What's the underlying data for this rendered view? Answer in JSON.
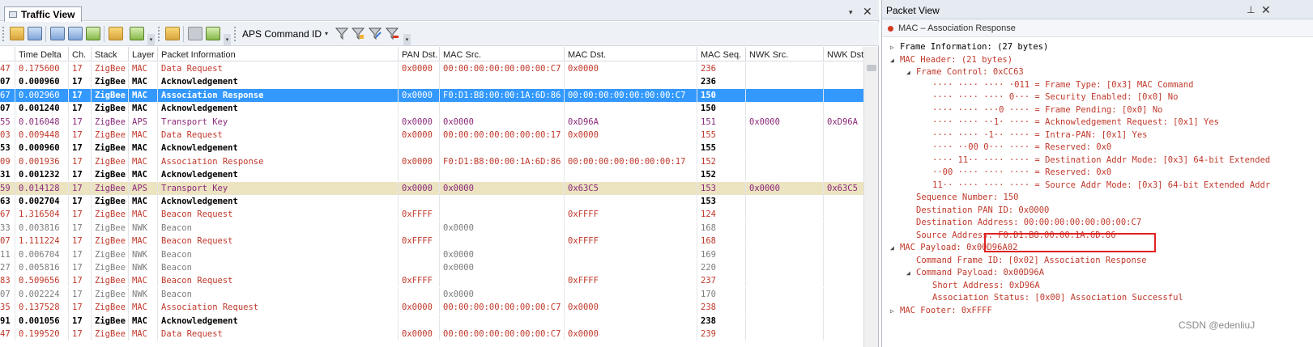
{
  "left_pane": {
    "tab_label": "Traffic View",
    "dropdown_glyph": "▾",
    "close_glyph": "✕"
  },
  "toolbar": {
    "protocol_filter": "APS Command ID",
    "combo_arrow": "▾"
  },
  "grid": {
    "columns": [
      "",
      "Time Delta",
      "Ch.",
      "Stack",
      "Layer",
      "Packet Information",
      "PAN Dst.",
      "MAC Src.",
      "MAC Dst.",
      "MAC Seq.",
      "NWK Src.",
      "NWK Dst."
    ],
    "rows": [
      {
        "id": "47",
        "time": "0.175600",
        "ch": "17",
        "stack": "ZigBee",
        "layer": "MAC",
        "info": "Data Request",
        "pan": "0x0000",
        "msrc": "00:00:00:00:00:00:00:C7",
        "mdst": "0x0000",
        "seq": "236",
        "nsrc": "",
        "ndst": "",
        "style": "red"
      },
      {
        "id": "07",
        "time": "0.000960",
        "ch": "17",
        "stack": "ZigBee",
        "layer": "MAC",
        "info": "Acknowledgement",
        "pan": "",
        "msrc": "",
        "mdst": "",
        "seq": "236",
        "nsrc": "",
        "ndst": "",
        "style": "black"
      },
      {
        "id": "67",
        "time": "0.002960",
        "ch": "17",
        "stack": "ZigBee",
        "layer": "MAC",
        "info": "Association Response",
        "pan": "0x0000",
        "msrc": "F0:D1:B8:00:00:1A:6D:86",
        "mdst": "00:00:00:00:00:00:00:C7",
        "seq": "150",
        "nsrc": "",
        "ndst": "",
        "style": "selected"
      },
      {
        "id": "07",
        "time": "0.001240",
        "ch": "17",
        "stack": "ZigBee",
        "layer": "MAC",
        "info": "Acknowledgement",
        "pan": "",
        "msrc": "",
        "mdst": "",
        "seq": "150",
        "nsrc": "",
        "ndst": "",
        "style": "black"
      },
      {
        "id": "55",
        "time": "0.016048",
        "ch": "17",
        "stack": "ZigBee",
        "layer": "APS",
        "info": "Transport Key",
        "pan": "0x0000",
        "msrc": "0x0000",
        "mdst": "0xD96A",
        "seq": "151",
        "nsrc": "0x0000",
        "ndst": "0xD96A",
        "style": "purple"
      },
      {
        "id": "03",
        "time": "0.009448",
        "ch": "17",
        "stack": "ZigBee",
        "layer": "MAC",
        "info": "Data Request",
        "pan": "0x0000",
        "msrc": "00:00:00:00:00:00:00:17",
        "mdst": "0x0000",
        "seq": "155",
        "nsrc": "",
        "ndst": "",
        "style": "red"
      },
      {
        "id": "53",
        "time": "0.000960",
        "ch": "17",
        "stack": "ZigBee",
        "layer": "MAC",
        "info": "Acknowledgement",
        "pan": "",
        "msrc": "",
        "mdst": "",
        "seq": "155",
        "nsrc": "",
        "ndst": "",
        "style": "black"
      },
      {
        "id": "09",
        "time": "0.001936",
        "ch": "17",
        "stack": "ZigBee",
        "layer": "MAC",
        "info": "Association Response",
        "pan": "0x0000",
        "msrc": "F0:D1:B8:00:00:1A:6D:86",
        "mdst": "00:00:00:00:00:00:00:17",
        "seq": "152",
        "nsrc": "",
        "ndst": "",
        "style": "red"
      },
      {
        "id": "31",
        "time": "0.001232",
        "ch": "17",
        "stack": "ZigBee",
        "layer": "MAC",
        "info": "Acknowledgement",
        "pan": "",
        "msrc": "",
        "mdst": "",
        "seq": "152",
        "nsrc": "",
        "ndst": "",
        "style": "black"
      },
      {
        "id": "59",
        "time": "0.014128",
        "ch": "17",
        "stack": "ZigBee",
        "layer": "APS",
        "info": "Transport Key",
        "pan": "0x0000",
        "msrc": "0x0000",
        "mdst": "0x63C5",
        "seq": "153",
        "nsrc": "0x0000",
        "ndst": "0x63C5",
        "style": "highlight"
      },
      {
        "id": "63",
        "time": "0.002704",
        "ch": "17",
        "stack": "ZigBee",
        "layer": "MAC",
        "info": "Acknowledgement",
        "pan": "",
        "msrc": "",
        "mdst": "",
        "seq": "153",
        "nsrc": "",
        "ndst": "",
        "style": "black"
      },
      {
        "id": "67",
        "time": "1.316504",
        "ch": "17",
        "stack": "ZigBee",
        "layer": "MAC",
        "info": "Beacon Request",
        "pan": "0xFFFF",
        "msrc": "",
        "mdst": "0xFFFF",
        "seq": "124",
        "nsrc": "",
        "ndst": "",
        "style": "red"
      },
      {
        "id": "33",
        "time": "0.003816",
        "ch": "17",
        "stack": "ZigBee",
        "layer": "NWK",
        "info": "Beacon",
        "pan": "",
        "msrc": "0x0000",
        "mdst": "",
        "seq": "168",
        "nsrc": "",
        "ndst": "",
        "style": "gray"
      },
      {
        "id": "07",
        "time": "1.111224",
        "ch": "17",
        "stack": "ZigBee",
        "layer": "MAC",
        "info": "Beacon Request",
        "pan": "0xFFFF",
        "msrc": "",
        "mdst": "0xFFFF",
        "seq": "168",
        "nsrc": "",
        "ndst": "",
        "style": "red"
      },
      {
        "id": "11",
        "time": "0.006704",
        "ch": "17",
        "stack": "ZigBee",
        "layer": "NWK",
        "info": "Beacon",
        "pan": "",
        "msrc": "0x0000",
        "mdst": "",
        "seq": "169",
        "nsrc": "",
        "ndst": "",
        "style": "gray"
      },
      {
        "id": "27",
        "time": "0.005816",
        "ch": "17",
        "stack": "ZigBee",
        "layer": "NWK",
        "info": "Beacon",
        "pan": "",
        "msrc": "0x0000",
        "mdst": "",
        "seq": "220",
        "nsrc": "",
        "ndst": "",
        "style": "gray"
      },
      {
        "id": "83",
        "time": "0.509656",
        "ch": "17",
        "stack": "ZigBee",
        "layer": "MAC",
        "info": "Beacon Request",
        "pan": "0xFFFF",
        "msrc": "",
        "mdst": "0xFFFF",
        "seq": "237",
        "nsrc": "",
        "ndst": "",
        "style": "red"
      },
      {
        "id": "07",
        "time": "0.002224",
        "ch": "17",
        "stack": "ZigBee",
        "layer": "NWK",
        "info": "Beacon",
        "pan": "",
        "msrc": "0x0000",
        "mdst": "",
        "seq": "170",
        "nsrc": "",
        "ndst": "",
        "style": "gray"
      },
      {
        "id": "35",
        "time": "0.137528",
        "ch": "17",
        "stack": "ZigBee",
        "layer": "MAC",
        "info": "Association Request",
        "pan": "0x0000",
        "msrc": "00:00:00:00:00:00:00:C7",
        "mdst": "0x0000",
        "seq": "238",
        "nsrc": "",
        "ndst": "",
        "style": "red"
      },
      {
        "id": "91",
        "time": "0.001056",
        "ch": "17",
        "stack": "ZigBee",
        "layer": "MAC",
        "info": "Acknowledgement",
        "pan": "",
        "msrc": "",
        "mdst": "",
        "seq": "238",
        "nsrc": "",
        "ndst": "",
        "style": "black"
      },
      {
        "id": "47",
        "time": "0.199520",
        "ch": "17",
        "stack": "ZigBee",
        "layer": "MAC",
        "info": "Data Request",
        "pan": "0x0000",
        "msrc": "00:00:00:00:00:00:00:C7",
        "mdst": "0x0000",
        "seq": "239",
        "nsrc": "",
        "ndst": "",
        "style": "red"
      }
    ]
  },
  "right_pane": {
    "title": "Packet View",
    "pin_glyph": "⊥",
    "close_glyph": "✕",
    "subtitle": "MAC – Association Response",
    "tree": [
      {
        "text": "Frame Information: (27 bytes)",
        "indent": 0,
        "toggle": "▷",
        "color": "black"
      },
      {
        "text": "MAC Header: (21 bytes)",
        "indent": 0,
        "toggle": "◢",
        "color": "red"
      },
      {
        "text": "Frame Control: 0xCC63",
        "indent": 1,
        "toggle": "◢",
        "color": "red"
      },
      {
        "text": "···· ···· ···· ·011 = Frame Type: [0x3] MAC Command",
        "indent": 2,
        "toggle": "",
        "color": "red"
      },
      {
        "text": "···· ···· ···· 0··· = Security Enabled: [0x0] No",
        "indent": 2,
        "toggle": "",
        "color": "red"
      },
      {
        "text": "···· ···· ···0 ···· = Frame Pending: [0x0] No",
        "indent": 2,
        "toggle": "",
        "color": "red"
      },
      {
        "text": "···· ···· ··1· ···· = Acknowledgement Request: [0x1] Yes",
        "indent": 2,
        "toggle": "",
        "color": "red"
      },
      {
        "text": "···· ···· ·1·· ···· = Intra-PAN: [0x1] Yes",
        "indent": 2,
        "toggle": "",
        "color": "red"
      },
      {
        "text": "···· ··00 0··· ···· = Reserved: 0x0",
        "indent": 2,
        "toggle": "",
        "color": "red"
      },
      {
        "text": "···· 11·· ···· ···· = Destination Addr Mode: [0x3] 64-bit Extended",
        "indent": 2,
        "toggle": "",
        "color": "red"
      },
      {
        "text": "··00 ···· ···· ···· = Reserved: 0x0",
        "indent": 2,
        "toggle": "",
        "color": "red"
      },
      {
        "text": "11·· ···· ···· ···· = Source Addr Mode: [0x3] 64-bit Extended Addr",
        "indent": 2,
        "toggle": "",
        "color": "red"
      },
      {
        "text": "Sequence Number: 150",
        "indent": 1,
        "toggle": "",
        "color": "red"
      },
      {
        "text": "Destination PAN ID: 0x0000",
        "indent": 1,
        "toggle": "",
        "color": "red"
      },
      {
        "text": "Destination Address: 00:00:00:00:00:00:00:C7",
        "indent": 1,
        "toggle": "",
        "color": "red"
      },
      {
        "text": "Source Address: F0:D1:B8:00:00:1A:6D:86",
        "indent": 1,
        "toggle": "",
        "color": "red"
      },
      {
        "text": "MAC Payload: 0x00D96A02",
        "indent": 0,
        "toggle": "◢",
        "color": "red"
      },
      {
        "text": "Command Frame ID: [0x02] Association Response",
        "indent": 1,
        "toggle": "",
        "color": "red"
      },
      {
        "text": "Command Payload: 0x00D96A",
        "indent": 1,
        "toggle": "◢",
        "color": "red"
      },
      {
        "text": "Short Address: 0xD96A",
        "indent": 2,
        "toggle": "",
        "color": "red"
      },
      {
        "text": "Association Status: [0x00] Association Successful",
        "indent": 2,
        "toggle": "",
        "color": "red"
      },
      {
        "text": "MAC Footer: 0xFFFF",
        "indent": 0,
        "toggle": "▷",
        "color": "red"
      }
    ]
  },
  "watermark": "CSDN @edenliuJ",
  "colors": {
    "selected_row": "#3399ff",
    "highlight_row": "#ece3c1",
    "red_text": "#c0392b",
    "purple_text": "#8a2a7a",
    "annotation_box": "#e02020"
  },
  "icons": [
    "open-folder-icon",
    "save-icon",
    "layout-icon",
    "view-icon",
    "export-icon",
    "highlight-icon",
    "settings-gear-icon",
    "copy-icon",
    "back-icon",
    "forward-icon",
    "filter-icon",
    "filter-add-icon",
    "filter-edit-icon",
    "filter-remove-icon"
  ]
}
